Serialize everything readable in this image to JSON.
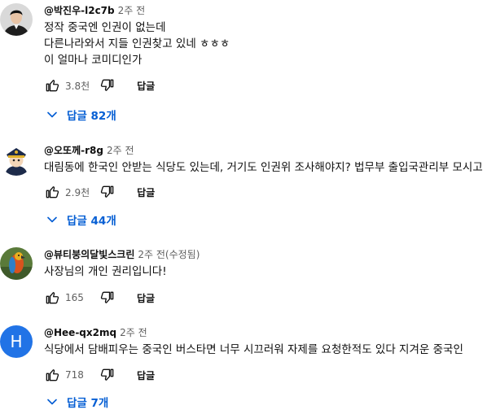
{
  "comments": [
    {
      "author": "@박진우-l2c7b",
      "time": "2주 전",
      "text": "정작 중국엔 인권이 없는데\n다른나라와서 지들 인권찾고 있네 ㅎㅎㅎ\n이 얼마나 코미디인가",
      "likes": "3.8천",
      "reply_label": "답글",
      "replies_label": "답글 82개"
    },
    {
      "author": "@오또께-r8g",
      "time": "2주 전",
      "text": "대림동에 한국인 안받는 식당도 있는데, 거기도 인권위 조사해야지? 법무부 출입국관리부 모시고",
      "likes": "2.9천",
      "reply_label": "답글",
      "replies_label": "답글 44개"
    },
    {
      "author": "@뷰티붕의달빛스크린",
      "time": "2주 전(수정됨)",
      "text": "사장님의 개인 권리입니다!",
      "likes": "165",
      "reply_label": "답글"
    },
    {
      "author": "@Hee-qx2mq",
      "time": "2주 전",
      "avatar_letter": "H",
      "text": "식당에서 담배피우는 중국인 버스타면  너무 시끄러워  자제를 요청한적도 있다 지겨운 중국인",
      "likes": "718",
      "reply_label": "답글",
      "replies_label": "답글 7개"
    }
  ],
  "colors": {
    "accent": "#065fd4",
    "avatar_h": "#2173e6"
  }
}
